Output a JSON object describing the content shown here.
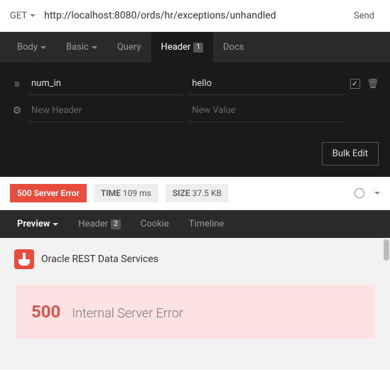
{
  "request": {
    "method": "GET",
    "url": "http://localhost:8080/ords/hr/exceptions/unhandled",
    "send_label": "Send"
  },
  "req_tabs": {
    "body": "Body",
    "basic": "Basic",
    "query": "Query",
    "header": "Header",
    "header_count": "1",
    "docs": "Docs"
  },
  "headers": {
    "rows": [
      {
        "key": "num_in",
        "value": "hello",
        "checked": true
      }
    ],
    "new_key_ph": "New Header",
    "new_val_ph": "New Value",
    "bulk_edit": "Bulk Edit"
  },
  "response": {
    "status_code": "500",
    "status_text": "Server Error",
    "time_label": "TIME",
    "time_value": "109 ms",
    "size_label": "SIZE",
    "size_value": "37.5 KB"
  },
  "resp_tabs": {
    "preview": "Preview",
    "header": "Header",
    "header_count": "2",
    "cookie": "Cookie",
    "timeline": "Timeline"
  },
  "preview": {
    "service_title": "Oracle REST Data Services",
    "error_code": "500",
    "error_message": "Internal Server Error"
  }
}
